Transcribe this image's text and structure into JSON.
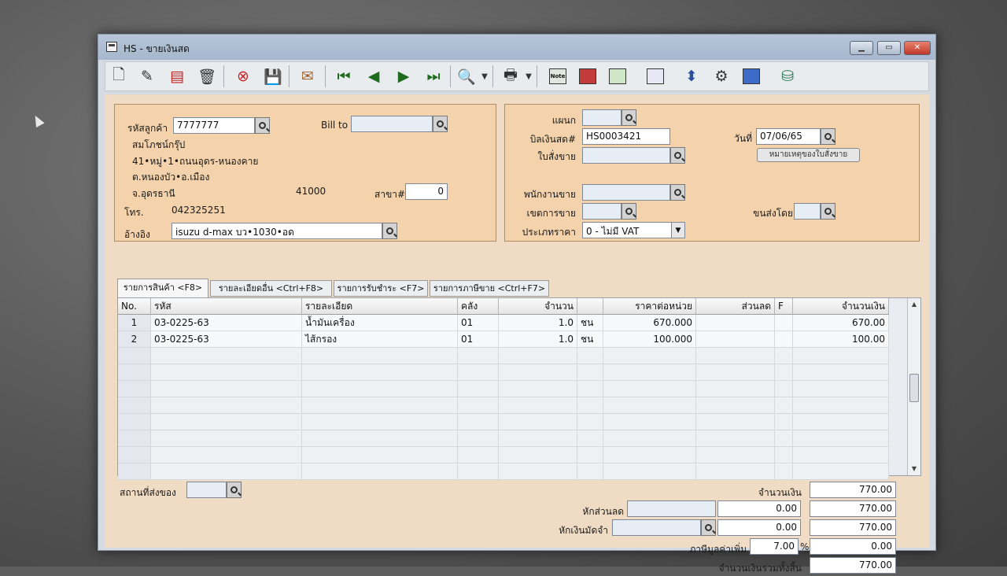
{
  "window": {
    "title": "HS - ขายเงินสด"
  },
  "toolbar": {
    "icons": [
      "new-document-icon",
      "edit-document-icon",
      "cancel-document-icon",
      "trash-icon",
      "close-circle-icon",
      "save-icon",
      "print-preview-icon",
      "first-record-icon",
      "previous-record-icon",
      "next-record-icon",
      "last-record-icon",
      "find-icon",
      "printer-icon",
      "note-icon",
      "calculator-icon",
      "exchange-icon",
      "document-list-icon",
      "approve-ok-icon",
      "tools-icon",
      "ok-icon",
      "database-icon"
    ]
  },
  "customer": {
    "code_label": "รหัสลูกค้า",
    "code": "7777777",
    "bill_to_label": "Bill to",
    "bill_to": "",
    "name": "สมโภชน์กรุ๊ป",
    "address1": "41•หมู่•1•ถนนอุดร-หนองคาย",
    "address2": "ต.หนองบัว•อ.เมือง",
    "province": "จ.อุดรธานี",
    "postcode": "41000",
    "branch_label": "สาขา#",
    "branch": "0",
    "phone_label": "โทร.",
    "phone": "042325251",
    "reference_label": "อ้างอิง",
    "reference": "isuzu d-max บว•1030•อด"
  },
  "document": {
    "department_label": "แผนก",
    "department": "",
    "bill_label": "บิลเงินสด#",
    "bill_no": "HS0003421",
    "date_label": "วันที่",
    "date": "07/06/65",
    "order_label": "ใบสั่งขาย",
    "order": "",
    "order_note_button": "หมายเหตุของใบสั่งขาย",
    "salesperson_label": "พนักงานขาย",
    "salesperson": "",
    "area_label": "เขตการขาย",
    "area": "",
    "ship_by_label": "ขนส่งโดย",
    "ship_by": "",
    "price_type_label": "ประเภทราคา",
    "price_type": "0 - ไม่มี VAT"
  },
  "tabs": [
    {
      "label": "รายการสินค้า <F8>",
      "active": true
    },
    {
      "label": "รายละเอียดอื่น <Ctrl+F8>",
      "active": false
    },
    {
      "label": "รายการรับชำระ <F7>",
      "active": false
    },
    {
      "label": "รายการภาษีขาย <Ctrl+F7>",
      "active": false
    }
  ],
  "table": {
    "headers": [
      "No.",
      "รหัส",
      "รายละเอียด",
      "คลัง",
      "จำนวน",
      "",
      "ราคาต่อหน่วย",
      "ส่วนลด",
      "F",
      "จำนวนเงิน"
    ],
    "rows": [
      [
        "1",
        "03-0225-63",
        "น้ำมันเครื่อง",
        "01",
        "1.0",
        "ชน",
        "670.000",
        "",
        "",
        "670.00"
      ],
      [
        "2",
        "03-0225-63",
        "ไส้กรอง",
        "01",
        "1.0",
        "ชน",
        "100.000",
        "",
        "",
        "100.00"
      ]
    ]
  },
  "footer": {
    "delivery_place_label": "สถานที่ส่งของ",
    "delivery_place": "",
    "amount_label": "จำนวนเงิน",
    "amount": "770.00",
    "discount_label": "หักส่วนลด",
    "discount_text": "",
    "discount_value": "0.00",
    "after_discount": "770.00",
    "deposit_label": "หักเงินมัดจำ",
    "deposit_text": "",
    "deposit_value": "0.00",
    "after_deposit": "770.00",
    "vat_label": "ภาษีมูลค่าเพิ่ม",
    "vat_rate": "7.00",
    "vat_percent_sign": "%",
    "vat_amount": "0.00",
    "grand_total_label": "จำนวนเงินรวมทั้งสิ้น",
    "grand_total": "770.00"
  }
}
